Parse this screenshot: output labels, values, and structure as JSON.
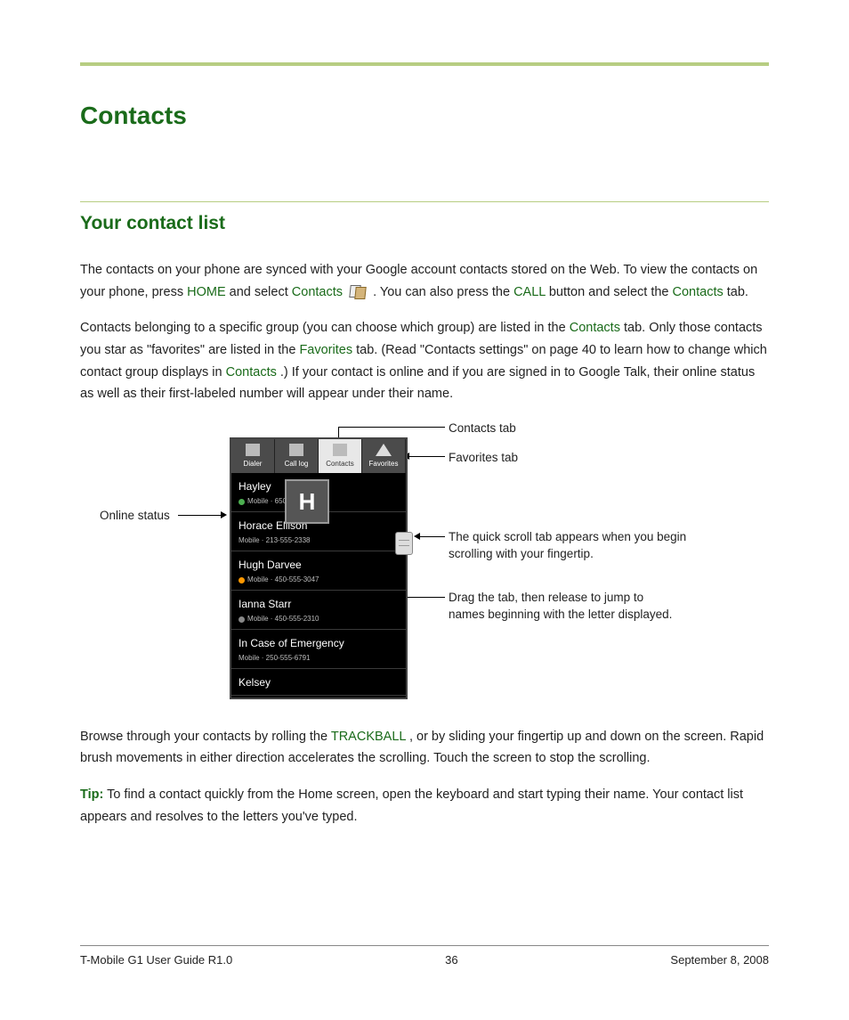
{
  "heading": "Contacts",
  "subheading": "Your contact list",
  "para1_a": "The contacts on your phone are synced with your Google account contacts stored on the Web. To view the contacts on your phone, press ",
  "kw_home": "HOME",
  "para1_b": " and select ",
  "kw_contacts": "Contacts",
  "para1_c": ". You can also press the ",
  "kw_call": "CALL",
  "para1_d": " button and select the ",
  "para1_e": " tab.",
  "para2_a": "Contacts belonging to a specific group (you can choose which group) are listed in the ",
  "para2_b": " tab. Only those contacts you star as \"favorites\" are listed in the ",
  "kw_favorites": "Favorites",
  "para2_c": " tab. (Read \"Contacts settings\" on page 40 to learn how to change which contact group displays in ",
  "para2_d": ".) If your contact is online and if you are signed in to Google Talk, their online status as well as their first-labeled number will appear under their name.",
  "callouts": {
    "online_status": "Online status",
    "contacts_tab": "Contacts tab",
    "favorites_tab": "Favorites tab",
    "quick_scroll": "The quick scroll tab appears when you begin scrolling with your fingertip.",
    "drag_tab": "Drag the tab, then release to jump to names beginning with the letter displayed."
  },
  "phone": {
    "tabs": {
      "dialer": "Dialer",
      "calllog": "Call log",
      "contacts": "Contacts",
      "favorites": "Favorites"
    },
    "letter": "H",
    "rows": [
      {
        "name": "Hayley",
        "sub": "Mobile · 650"
      },
      {
        "name": "Horace Ellison",
        "sub": "Mobile · 213-555-2338"
      },
      {
        "name": "Hugh Darvee",
        "sub": "Mobile · 450-555-3047"
      },
      {
        "name": "Ianna Starr",
        "sub": "Mobile · 450-555-2310"
      },
      {
        "name": "In Case of Emergency",
        "sub": "Mobile · 250-555-6791"
      },
      {
        "name": "Kelsey",
        "sub": ""
      }
    ]
  },
  "para3_a": "Browse through your contacts by rolling the ",
  "kw_trackball": "TRACKBALL",
  "para3_b": ", or by sliding your fingertip up and down on the screen. Rapid brush movements in either direction accelerates the scrolling. Touch the screen to stop the scrolling.",
  "tip_label": "Tip:",
  "tip_text": " To find a contact quickly from the Home screen, open the keyboard and start typing their name. Your contact list appears and resolves to the letters you've typed.",
  "footer": {
    "left": "T-Mobile G1 User Guide R1.0",
    "center": "36",
    "right": "September 8, 2008"
  }
}
